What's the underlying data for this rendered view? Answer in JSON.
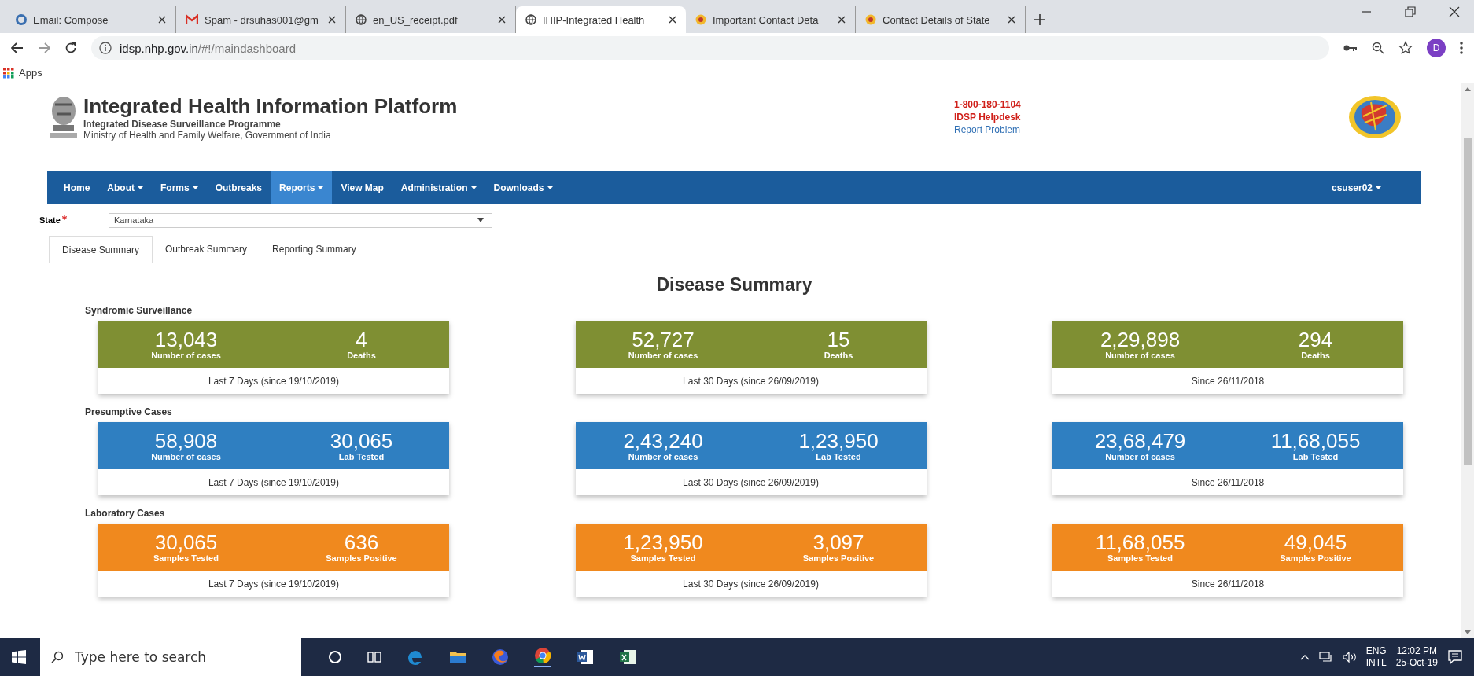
{
  "browser": {
    "tabs": [
      {
        "title": "Email: Compose",
        "kind": "ring",
        "selected": false
      },
      {
        "title": "Spam - drsuhas001@gm",
        "kind": "mail",
        "selected": false
      },
      {
        "title": "en_US_receipt.pdf",
        "kind": "web",
        "selected": false
      },
      {
        "title": "IHIP-Integrated Health",
        "kind": "web",
        "selected": true
      },
      {
        "title": "Important Contact Deta",
        "kind": "seal",
        "selected": false
      },
      {
        "title": "Contact Details of State",
        "kind": "seal",
        "selected": false
      }
    ],
    "address_host": "idsp.nhp.gov.in",
    "address_path": "/#!/maindashboard",
    "profile": "D",
    "bookmarks": [
      "Apps"
    ]
  },
  "header": {
    "title": "Integrated Health Information Platform",
    "programme": "Integrated Disease Surveillance Programme",
    "ministry": "Ministry of Health and Family Welfare, Government of India",
    "phone": "1-800-180-1104",
    "helpdesk": "IDSP Helpdesk",
    "report": "Report Problem"
  },
  "nav": {
    "items": [
      {
        "label": "Home",
        "dropdown": false,
        "selected": false
      },
      {
        "label": "About",
        "dropdown": true,
        "selected": false
      },
      {
        "label": "Forms",
        "dropdown": true,
        "selected": false
      },
      {
        "label": "Outbreaks",
        "dropdown": false,
        "selected": false
      },
      {
        "label": "Reports",
        "dropdown": true,
        "selected": true
      },
      {
        "label": "View Map",
        "dropdown": false,
        "selected": false
      },
      {
        "label": "Administration",
        "dropdown": true,
        "selected": false
      },
      {
        "label": "Downloads",
        "dropdown": true,
        "selected": false
      }
    ],
    "user": "csuser02"
  },
  "state_filter": {
    "label": "State",
    "required": true,
    "value": "Karnataka"
  },
  "page_tabs": [
    {
      "label": "Disease Summary",
      "selected": true
    },
    {
      "label": "Outbreak Summary",
      "selected": false
    },
    {
      "label": "Reporting Summary",
      "selected": false
    }
  ],
  "heading": "Disease Summary",
  "sections": [
    {
      "title": "Syndromic Surveillance",
      "color": "#7f8f33",
      "cards": [
        {
          "value_1": "13,043",
          "label_1": "Number of cases",
          "value_2": "4",
          "label_2": "Deaths",
          "footer": "Last 7 Days (since 19/10/2019)"
        },
        {
          "value_1": "52,727",
          "label_1": "Number of cases",
          "value_2": "15",
          "label_2": "Deaths",
          "footer": "Last 30 Days (since 26/09/2019)"
        },
        {
          "value_1": "2,29,898",
          "label_1": "Number of cases",
          "value_2": "294",
          "label_2": "Deaths",
          "footer": "Since 26/11/2018"
        }
      ]
    },
    {
      "title": "Presumptive Cases",
      "color": "#2f7fc1",
      "cards": [
        {
          "value_1": "58,908",
          "label_1": "Number of cases",
          "value_2": "30,065",
          "label_2": "Lab Tested",
          "footer": "Last 7 Days (since 19/10/2019)"
        },
        {
          "value_1": "2,43,240",
          "label_1": "Number of cases",
          "value_2": "1,23,950",
          "label_2": "Lab Tested",
          "footer": "Last 30 Days (since 26/09/2019)"
        },
        {
          "value_1": "23,68,479",
          "label_1": "Number of cases",
          "value_2": "11,68,055",
          "label_2": "Lab Tested",
          "footer": "Since 26/11/2018"
        }
      ]
    },
    {
      "title": "Laboratory Cases",
      "color": "#f0891e",
      "cards": [
        {
          "value_1": "30,065",
          "label_1": "Samples Tested",
          "value_2": "636",
          "label_2": "Samples Positive",
          "footer": "Last 7 Days (since 19/10/2019)"
        },
        {
          "value_1": "1,23,950",
          "label_1": "Samples Tested",
          "value_2": "3,097",
          "label_2": "Samples Positive",
          "footer": "Last 30 Days (since 26/09/2019)"
        },
        {
          "value_1": "11,68,055",
          "label_1": "Samples Tested",
          "value_2": "49,045",
          "label_2": "Samples Positive",
          "footer": "Since 26/11/2018"
        }
      ]
    }
  ],
  "taskbar": {
    "search_placeholder": "Type here to search",
    "language": "ENG",
    "layout": "INTL",
    "time": "12:02 PM",
    "date": "25-Oct-19"
  }
}
